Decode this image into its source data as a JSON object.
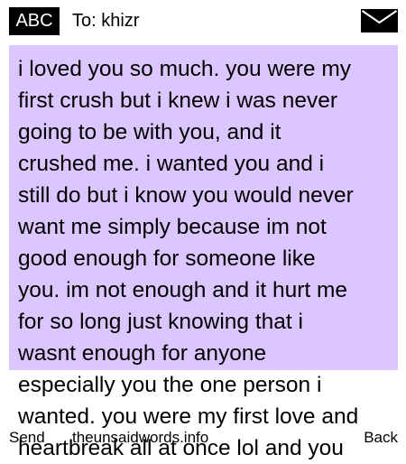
{
  "header": {
    "mode_label": "ABC",
    "recipient": "To: khizr",
    "icon": "envelope-icon"
  },
  "message": {
    "highlighted_text": "i loved you so much. you were my\nfirst crush but i knew i was never\ngoing to be with you, and it\ncrushed me. i wanted you and i\nstill do but i know you would never\nwant me simply because im not\ngood enough for someone like\nyou. im not enough and it hurt me\nfor so long just knowing that i\nwasnt enough for anyone",
    "continued_text": "especially you the one person i\nwanted. you were my first love and\nheartbreak all at once lol and you"
  },
  "footer": {
    "send_label": "Send",
    "site_label": "theunsaidwords.info",
    "back_label": "Back"
  },
  "colors": {
    "highlight": "#dcc6ff",
    "badge": "#000000"
  }
}
